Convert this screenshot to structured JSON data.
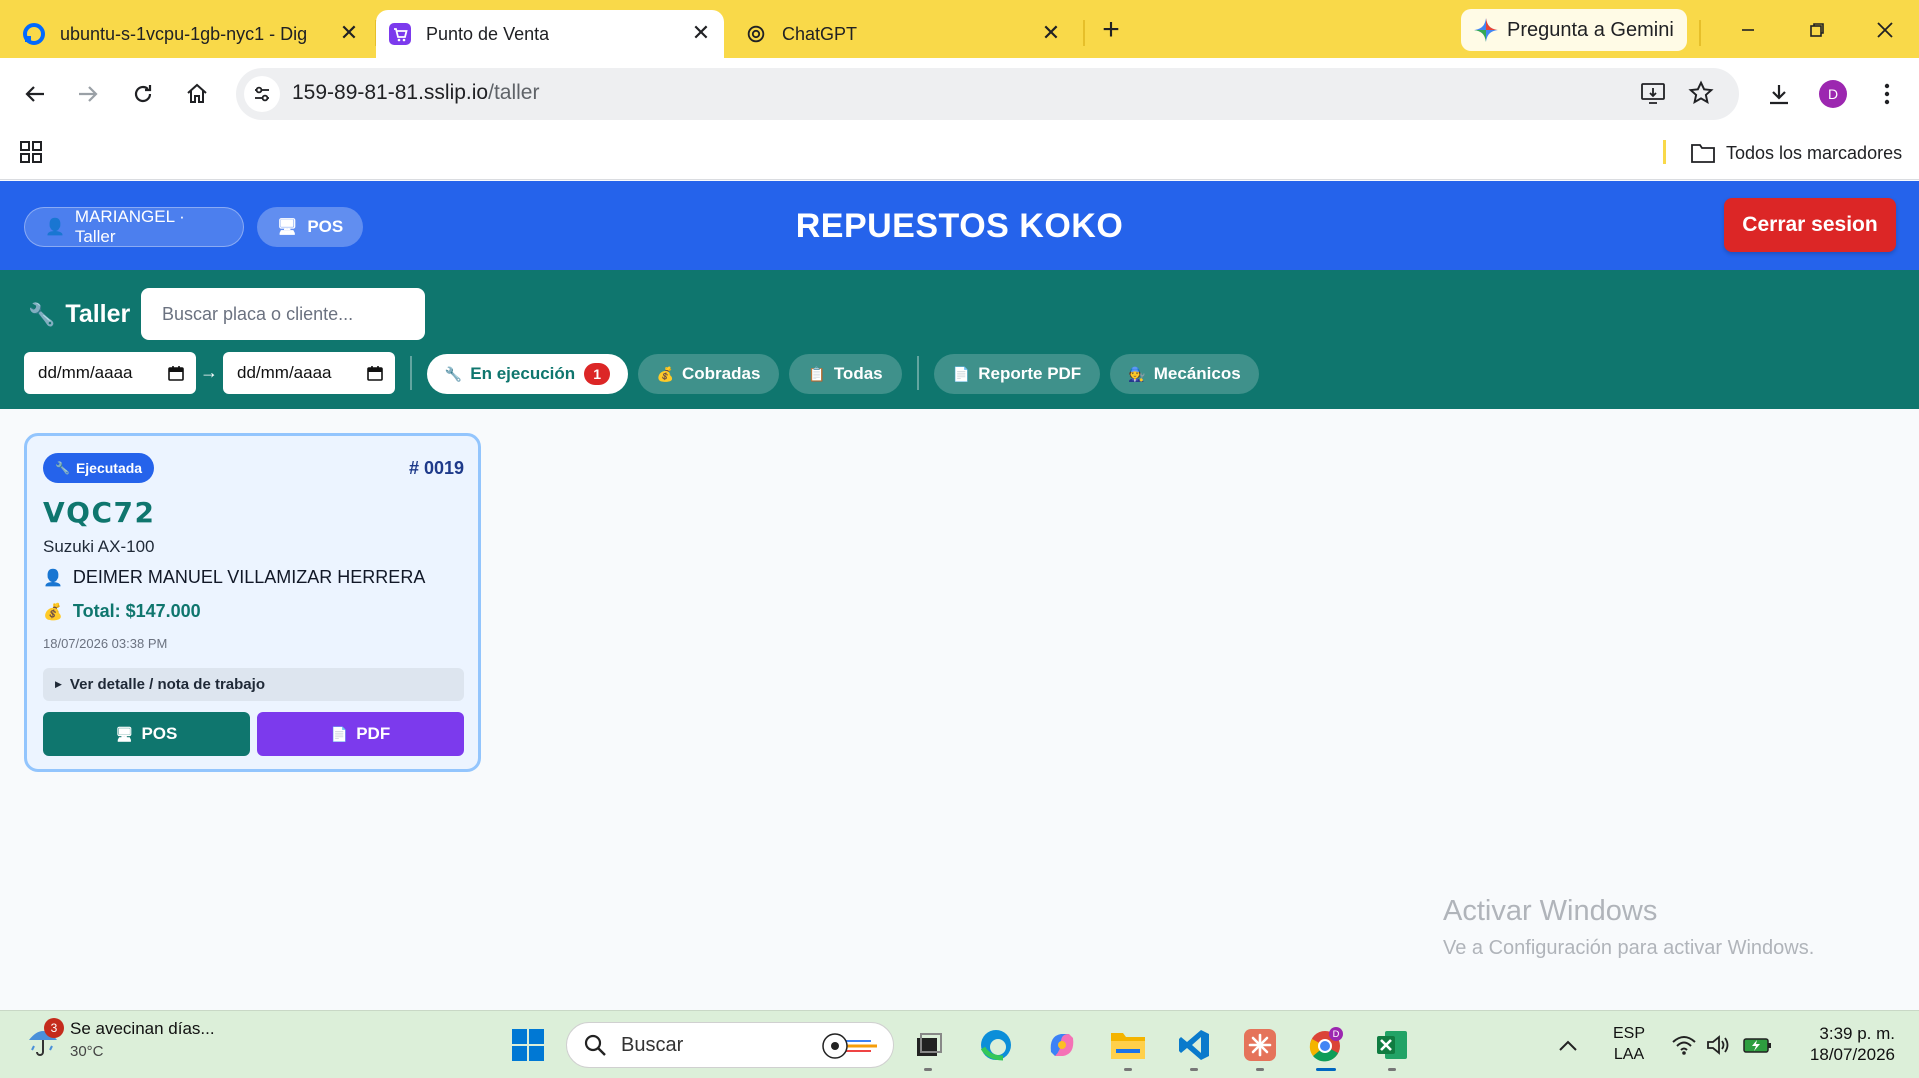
{
  "browser": {
    "tabs": [
      {
        "title": "ubuntu-s-1vcpu-1gb-nyc1 - Dig",
        "icon": "digitalocean-icon"
      },
      {
        "title": "Punto de Venta",
        "icon": "cart-icon",
        "active": true
      },
      {
        "title": "ChatGPT",
        "icon": "openai-icon"
      }
    ],
    "gemini_label": "Pregunta a Gemini",
    "url_host": "159-89-81-81.sslip.io",
    "url_path": "/taller",
    "profile_initial": "D",
    "bookmarks_label": "Todos los marcadores"
  },
  "app": {
    "user_label": "MARIANGEL · Taller",
    "pos_label": "POS",
    "brand": "REPUESTOS KOKO",
    "logout_label": "Cerrar sesion"
  },
  "toolbar": {
    "title": "Taller",
    "search_placeholder": "Buscar placa o cliente...",
    "date_from": "dd/mm/aaaa",
    "date_arrow": "→",
    "date_to": "dd/mm/aaaa",
    "filters": {
      "running": "En ejecución",
      "running_count": "1",
      "paid": "Cobradas",
      "all": "Todas",
      "report": "Reporte PDF",
      "mechanics": "Mecánicos"
    }
  },
  "orders": [
    {
      "status": "Ejecutada",
      "number": "# 0019",
      "plate": "VQC72",
      "vehicle": "Suzuki AX-100",
      "client": "DEIMER MANUEL VILLAMIZAR HERRERA",
      "total": "Total: $147.000",
      "date": "18/07/2026 03:38 PM",
      "detail_label": "Ver detalle / nota de trabajo",
      "pos_label": "POS",
      "pdf_label": "PDF"
    }
  ],
  "watermark": {
    "line1": "Activar Windows",
    "line2": "Ve a Configuración para activar Windows."
  },
  "taskbar": {
    "weather_badge": "3",
    "weather_text": "Se avecinan días...",
    "weather_temp": "30°C",
    "search_label": "Buscar",
    "lang_top": "ESP",
    "lang_bottom": "LAA",
    "time": "3:39 p. m.",
    "date": "18/07/2026"
  },
  "colors": {
    "header_blue": "#2563eb",
    "toolbar_teal": "#0f766e",
    "logout_red": "#dc2626",
    "pdf_purple": "#7c3aed",
    "chrome_yellow": "#f9d949"
  }
}
